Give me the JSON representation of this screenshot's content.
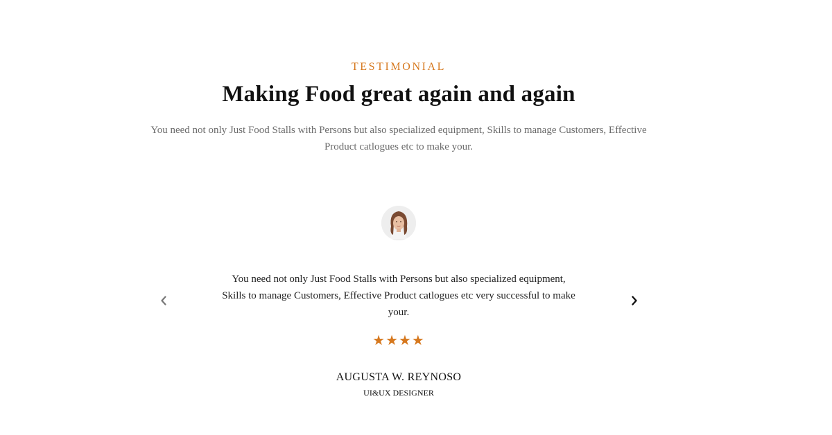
{
  "section": {
    "eyebrow": "TESTIMONIAL",
    "headline": "Making Food great again and again",
    "intro": "You need not only Just Food Stalls with Persons but also specialized equipment, Skills to manage Customers, Effective Product catlogues etc to make your."
  },
  "testimonial": {
    "avatar_icon": "woman-portrait-avatar",
    "quote": "You need not only Just Food Stalls with Persons but also specialized equipment, Skills to manage Customers, Effective Product catlogues etc very successful to make your.",
    "rating": 4,
    "stars": "★★★★",
    "author_name": "AUGUSTA W. REYNOSO",
    "author_role": "UI&UX DESIGNER"
  },
  "controls": {
    "prev_icon": "chevron-left-icon",
    "next_icon": "chevron-right-icon"
  },
  "colors": {
    "accent": "#d6781e",
    "heading": "#111111",
    "body_text": "#6b6b6b"
  }
}
